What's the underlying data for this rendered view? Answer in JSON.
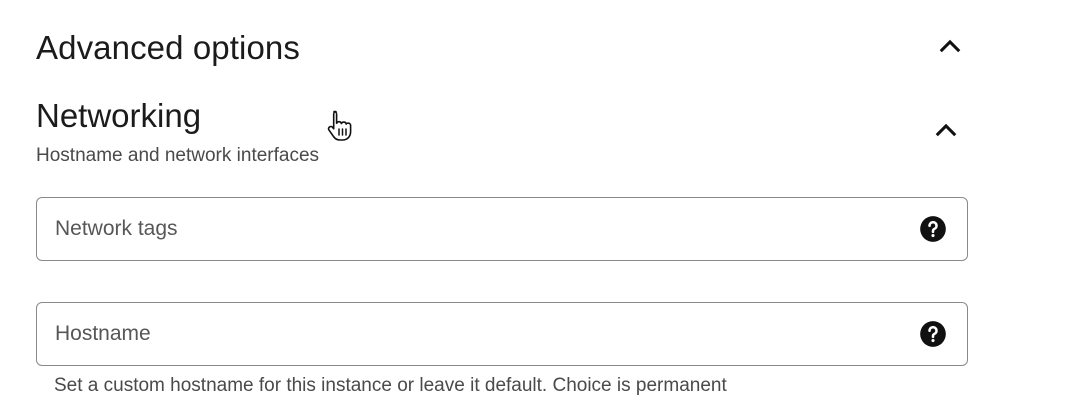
{
  "advanced_options": {
    "title": "Advanced options",
    "chevron_icon": "chevron-up-icon"
  },
  "networking": {
    "title": "Networking",
    "subtitle": "Hostname and network interfaces",
    "chevron_icon": "chevron-up-icon",
    "network_tags": {
      "placeholder": "Network tags",
      "value": "",
      "help_icon": "help-circle-icon"
    },
    "hostname": {
      "placeholder": "Hostname",
      "value": "",
      "help_icon": "help-circle-icon",
      "helper_text": "Set a custom hostname for this instance or leave it default. Choice is permanent"
    }
  },
  "colors": {
    "text_primary": "#1b1b1b",
    "text_secondary": "#4a4a4a",
    "border": "#8a8a8a",
    "icon": "#111111"
  },
  "cursor_icon": "hand-pointer-icon"
}
